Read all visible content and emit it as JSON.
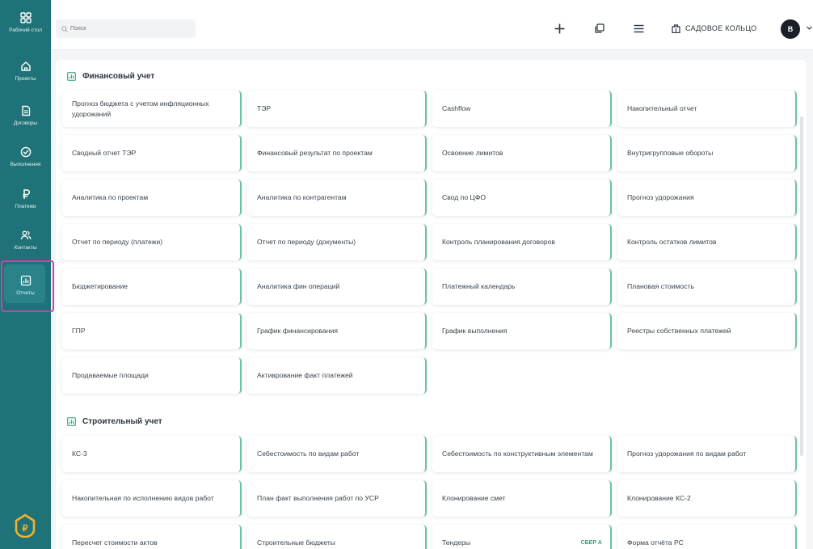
{
  "sidebar": {
    "items": [
      {
        "label": "Рабочий стол",
        "icon": "dashboard-icon"
      },
      {
        "label": "Проекты",
        "icon": "home-icon"
      },
      {
        "label": "Договоры",
        "icon": "document-icon"
      },
      {
        "label": "Выполнения",
        "icon": "check-circle-icon"
      },
      {
        "label": "Платежи",
        "icon": "ruble-icon"
      },
      {
        "label": "Контакты",
        "icon": "users-icon"
      },
      {
        "label": "Отчеты",
        "icon": "report-icon"
      }
    ],
    "active_index": 6
  },
  "topbar": {
    "search_placeholder": "Поиск",
    "org_name": "САДОВОЕ КОЛЬЦО",
    "avatar_letter": "В"
  },
  "sections": [
    {
      "title": "Финансовый учет",
      "cards": [
        "Прогноз бюджета с учетом инфляционных удорожаний",
        "ТЭР",
        "Cashflow",
        "Накопительный отчет",
        "Сводный отчет ТЭР",
        "Финансовый результат по проектам",
        "Освоение лимитов",
        "Внутригрупповые обороты",
        "Аналитика по проектам",
        "Аналитика по контрагентам",
        "Свод по ЦФО",
        "Прогноз удорожания",
        "Отчет по периоду (платежи)",
        "Отчет по периоду (документы)",
        "Контроль планирования договоров",
        "Контроль остатков лимитов",
        "Бюджетирование",
        "Аналитика фин операций",
        "Платежный календарь",
        "Плановая стоимость",
        "ГПР",
        "График финансирования",
        "График выполнения",
        "Реестры собственных платежей",
        "Продаваемые площади",
        "Активрование факт платежей"
      ]
    },
    {
      "title": "Строительный учет",
      "cards": [
        "КС-3",
        "Себестоимость по видам работ",
        "Себестоимость по конструктивным элементам",
        "Прогноз удорожания по видам работ",
        "Накопительная по исполнению видов работ",
        "План факт выполнения работ по УСР",
        "Клонирование смет",
        "Клонирование КС-2",
        "Пересчет стоимости актов",
        "Строительные бюджеты",
        "Тендеры",
        "Форма отчёта РС"
      ],
      "badge": {
        "card_index": 10,
        "text": "СБЕР А"
      }
    }
  ],
  "colors": {
    "sidebar": "#1f7378",
    "card_accent": "#6cc1a8",
    "highlight": "#d33ea3",
    "text": "#2b3440"
  }
}
